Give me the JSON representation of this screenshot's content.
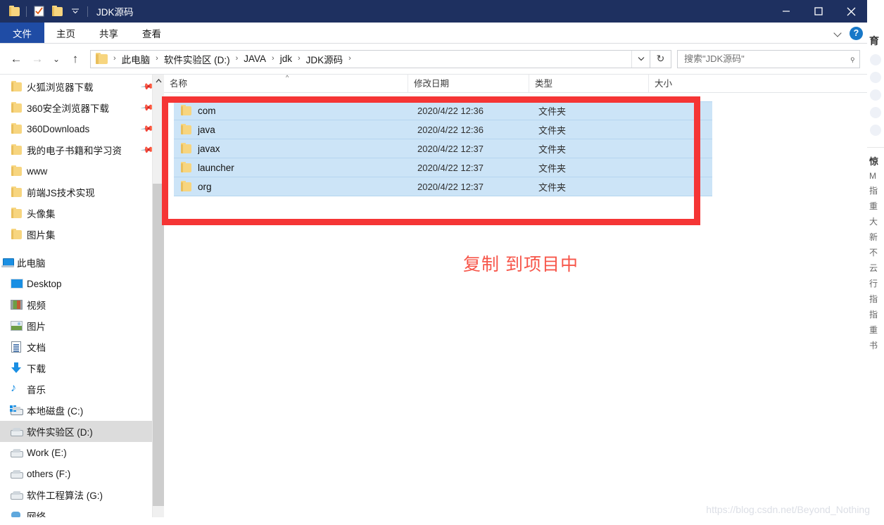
{
  "window": {
    "title": "JDK源码",
    "quick_access": [
      {
        "name": "folder-icon",
        "label": "属性"
      },
      {
        "name": "properties-icon",
        "label": "属性"
      },
      {
        "name": "new-folder-icon",
        "label": "新建文件夹"
      },
      {
        "name": "customize-dropdown-icon",
        "label": "自定义快速访问工具栏"
      }
    ],
    "controls": {
      "minimize": "—",
      "maximize": "□",
      "close": "✕"
    }
  },
  "ribbon": {
    "tabs": [
      {
        "label": "文件",
        "active": true
      },
      {
        "label": "主页",
        "active": false
      },
      {
        "label": "共享",
        "active": false
      },
      {
        "label": "查看",
        "active": false
      }
    ],
    "collapse_icon": "chevron-down-icon",
    "help_label": "?"
  },
  "navigation": {
    "back": "←",
    "forward": "→",
    "recent": "⌄",
    "up": "↑",
    "breadcrumbs": [
      "此电脑",
      "软件实验区 (D:)",
      "JAVA",
      "jdk",
      "JDK源码"
    ],
    "breadcrumb_separator": "›",
    "dropdown_icon": "chevron-down-icon",
    "refresh_icon": "↻",
    "search": {
      "placeholder": "搜索\"JDK源码\"",
      "value": "",
      "icon": "search-icon"
    }
  },
  "sidebar": {
    "quick_items": [
      {
        "label": "火狐浏览器下载",
        "icon": "folder-icon",
        "pinned": true
      },
      {
        "label": "360安全浏览器下载",
        "icon": "folder-icon",
        "pinned": true
      },
      {
        "label": "360Downloads",
        "icon": "folder-icon",
        "pinned": true
      },
      {
        "label": "我的电子书籍和学习资",
        "icon": "folder-icon",
        "pinned": true
      },
      {
        "label": "www",
        "icon": "folder-icon",
        "pinned": false
      },
      {
        "label": "前端JS技术实现",
        "icon": "folder-icon",
        "pinned": false
      },
      {
        "label": "头像集",
        "icon": "folder-icon",
        "pinned": false
      },
      {
        "label": "图片集",
        "icon": "folder-icon",
        "pinned": false
      }
    ],
    "this_pc": {
      "label": "此电脑",
      "icon": "computer-icon"
    },
    "pc_items": [
      {
        "label": "Desktop",
        "icon": "desktop-icon",
        "selected": false
      },
      {
        "label": "视频",
        "icon": "video-icon",
        "selected": false
      },
      {
        "label": "图片",
        "icon": "picture-icon",
        "selected": false
      },
      {
        "label": "文档",
        "icon": "document-icon",
        "selected": false
      },
      {
        "label": "下载",
        "icon": "download-icon",
        "selected": false
      },
      {
        "label": "音乐",
        "icon": "music-icon",
        "selected": false
      },
      {
        "label": "本地磁盘 (C:)",
        "icon": "windows-drive-icon",
        "selected": false
      },
      {
        "label": "软件实验区 (D:)",
        "icon": "drive-icon",
        "selected": true
      },
      {
        "label": "Work (E:)",
        "icon": "drive-icon",
        "selected": false
      },
      {
        "label": "others (F:)",
        "icon": "drive-icon",
        "selected": false
      },
      {
        "label": "软件工程算法 (G:)",
        "icon": "drive-icon",
        "selected": false
      },
      {
        "label": "网络",
        "icon": "network-icon",
        "selected": false
      }
    ]
  },
  "filelist": {
    "columns": [
      {
        "label": "名称",
        "sorted": true,
        "sort_arrow": "^"
      },
      {
        "label": "修改日期",
        "sorted": false,
        "sort_arrow": ""
      },
      {
        "label": "类型",
        "sorted": false,
        "sort_arrow": ""
      },
      {
        "label": "大小",
        "sorted": false,
        "sort_arrow": ""
      }
    ],
    "rows": [
      {
        "name": "com",
        "date": "2020/4/22 12:36",
        "type": "文件夹",
        "size": "",
        "icon": "folder-icon",
        "selected": true
      },
      {
        "name": "java",
        "date": "2020/4/22 12:36",
        "type": "文件夹",
        "size": "",
        "icon": "folder-icon",
        "selected": true
      },
      {
        "name": "javax",
        "date": "2020/4/22 12:37",
        "type": "文件夹",
        "size": "",
        "icon": "folder-icon",
        "selected": true
      },
      {
        "name": "launcher",
        "date": "2020/4/22 12:37",
        "type": "文件夹",
        "size": "",
        "icon": "folder-icon",
        "selected": true
      },
      {
        "name": "org",
        "date": "2020/4/22 12:37",
        "type": "文件夹",
        "size": "",
        "icon": "folder-icon",
        "selected": true
      }
    ]
  },
  "annotations": {
    "note_text": "复制 到项目中",
    "note_color": "#f7564a",
    "rect_color": "#f53535"
  },
  "watermark": "https://blog.csdn.net/Beyond_Nothing",
  "background_page": {
    "heading": "育",
    "section_heading": "惊",
    "lines": [
      "M",
      "指",
      "重",
      "大",
      "新",
      "不",
      "云",
      "行",
      "指",
      "指",
      "重",
      "书"
    ]
  }
}
